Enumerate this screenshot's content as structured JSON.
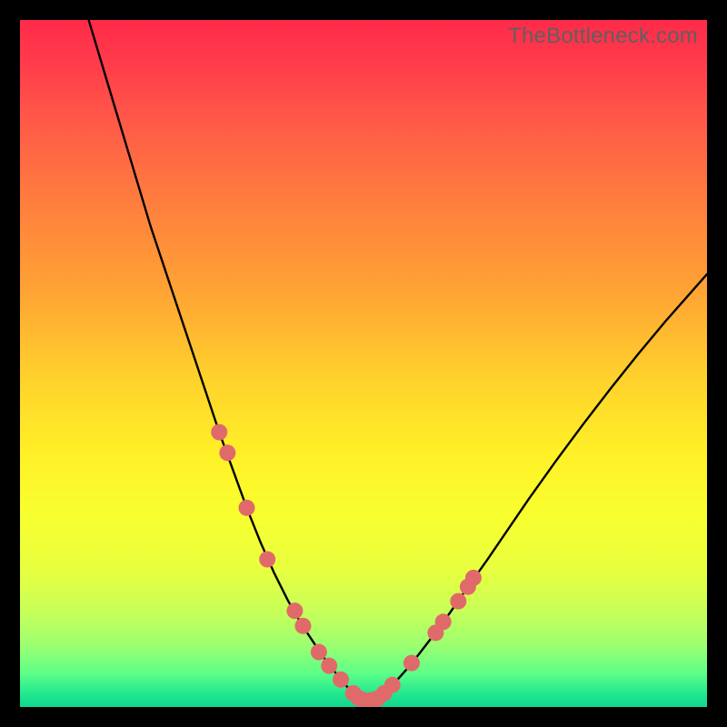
{
  "watermark": "TheBottleneck.com",
  "chart_data": {
    "type": "line",
    "title": "",
    "xlabel": "",
    "ylabel": "",
    "xlim": [
      0,
      100
    ],
    "ylim": [
      0,
      100
    ],
    "series": [
      {
        "name": "curve-left",
        "x": [
          10,
          13,
          16,
          19,
          22,
          25,
          27,
          29,
          31,
          33,
          35,
          37,
          39,
          41,
          43,
          44.5,
          46,
          47.3,
          48.4,
          49.3
        ],
        "y": [
          100,
          90,
          80,
          70,
          61,
          52,
          46,
          40,
          34.5,
          29,
          24,
          19.5,
          15.5,
          12,
          9,
          6.8,
          4.9,
          3.3,
          2.1,
          1.2
        ]
      },
      {
        "name": "curve-floor",
        "x": [
          49.3,
          50,
          51,
          52
        ],
        "y": [
          1.2,
          1.0,
          1.0,
          1.2
        ]
      },
      {
        "name": "curve-right",
        "x": [
          52,
          53.2,
          54.6,
          56.2,
          58,
          60,
          62.5,
          65,
          68,
          71,
          74,
          78,
          82,
          86,
          90,
          94,
          97,
          100
        ],
        "y": [
          1.2,
          2.2,
          3.6,
          5.4,
          7.6,
          10.2,
          13.6,
          17.2,
          21.4,
          25.8,
          30.2,
          35.8,
          41.2,
          46.4,
          51.4,
          56.2,
          59.6,
          63
        ]
      }
    ],
    "markers": {
      "name": "dots",
      "color": "#e06a6a",
      "radius_px": 9,
      "points": [
        {
          "x": 29.0,
          "y": 40.0
        },
        {
          "x": 30.2,
          "y": 37.0
        },
        {
          "x": 33.0,
          "y": 29.0
        },
        {
          "x": 36.0,
          "y": 21.5
        },
        {
          "x": 40.0,
          "y": 14.0
        },
        {
          "x": 41.2,
          "y": 11.8
        },
        {
          "x": 43.5,
          "y": 8.0
        },
        {
          "x": 45.0,
          "y": 6.0
        },
        {
          "x": 46.7,
          "y": 4.0
        },
        {
          "x": 48.5,
          "y": 2.0
        },
        {
          "x": 49.3,
          "y": 1.3
        },
        {
          "x": 50.0,
          "y": 1.0
        },
        {
          "x": 51.2,
          "y": 1.0
        },
        {
          "x": 52.0,
          "y": 1.2
        },
        {
          "x": 53.0,
          "y": 2.0
        },
        {
          "x": 54.2,
          "y": 3.2
        },
        {
          "x": 57.0,
          "y": 6.4
        },
        {
          "x": 60.5,
          "y": 10.8
        },
        {
          "x": 61.6,
          "y": 12.4
        },
        {
          "x": 63.8,
          "y": 15.4
        },
        {
          "x": 65.2,
          "y": 17.5
        },
        {
          "x": 66.0,
          "y": 18.8
        }
      ]
    }
  }
}
